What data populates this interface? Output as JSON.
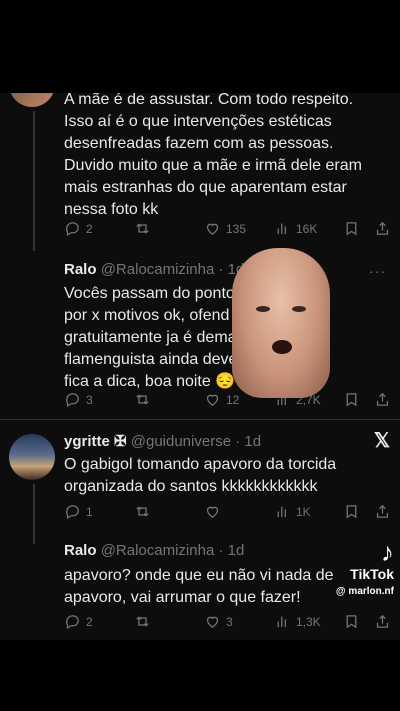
{
  "tweets": [
    {
      "body": "A mãe é de assustar. Com todo respeito.\nIsso aí é o que intervenções estéticas\ndesenfreadas fazem com as pessoas.\nDuvido muito que a mãe e irmã dele eram\nmais estranhas do que aparentam estar\nnessa foto kk",
      "replies": "2",
      "retweets": "",
      "likes": "135",
      "views": "16K"
    },
    {
      "name": "Ralo",
      "handle": "@Ralocamizinha",
      "time": "1d",
      "body": "Vocês passam do ponto.              gador\npor x motivos ok, ofend\ngratuitamente ja é demai               o\nflamenguista ainda dever               gonha.\nfica a dica, boa noite 😔",
      "replies": "3",
      "retweets": "",
      "likes": "12",
      "views": "2,7K"
    },
    {
      "name": "ygritte ✠",
      "handle": "@guiduniverse",
      "time": "1d",
      "body": "O gabigol tomando apavoro da torcida\norganizada do santos kkkkkkkkkkkk",
      "replies": "1",
      "retweets": "",
      "likes": "",
      "views": "1K"
    },
    {
      "name": "Ralo",
      "handle": "@Ralocamizinha",
      "time": "1d",
      "body": "apavoro? onde que eu não vi nada de\napavoro, vai arrumar o que fazer!",
      "replies": "2",
      "retweets": "",
      "likes": "3",
      "views": "1,3K"
    }
  ],
  "dot": "·",
  "more": "···",
  "x_logo": "𝕏",
  "tiktok": {
    "brand": "TikTok",
    "user": "@ marlon.nf"
  }
}
